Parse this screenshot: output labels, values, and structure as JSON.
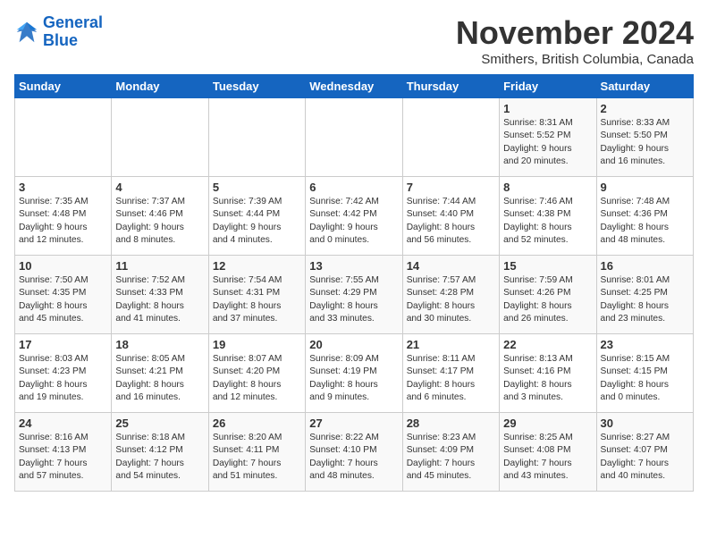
{
  "logo": {
    "line1": "General",
    "line2": "Blue"
  },
  "title": "November 2024",
  "subtitle": "Smithers, British Columbia, Canada",
  "weekdays": [
    "Sunday",
    "Monday",
    "Tuesday",
    "Wednesday",
    "Thursday",
    "Friday",
    "Saturday"
  ],
  "weeks": [
    [
      {
        "day": "",
        "info": ""
      },
      {
        "day": "",
        "info": ""
      },
      {
        "day": "",
        "info": ""
      },
      {
        "day": "",
        "info": ""
      },
      {
        "day": "",
        "info": ""
      },
      {
        "day": "1",
        "info": "Sunrise: 8:31 AM\nSunset: 5:52 PM\nDaylight: 9 hours\nand 20 minutes."
      },
      {
        "day": "2",
        "info": "Sunrise: 8:33 AM\nSunset: 5:50 PM\nDaylight: 9 hours\nand 16 minutes."
      }
    ],
    [
      {
        "day": "3",
        "info": "Sunrise: 7:35 AM\nSunset: 4:48 PM\nDaylight: 9 hours\nand 12 minutes."
      },
      {
        "day": "4",
        "info": "Sunrise: 7:37 AM\nSunset: 4:46 PM\nDaylight: 9 hours\nand 8 minutes."
      },
      {
        "day": "5",
        "info": "Sunrise: 7:39 AM\nSunset: 4:44 PM\nDaylight: 9 hours\nand 4 minutes."
      },
      {
        "day": "6",
        "info": "Sunrise: 7:42 AM\nSunset: 4:42 PM\nDaylight: 9 hours\nand 0 minutes."
      },
      {
        "day": "7",
        "info": "Sunrise: 7:44 AM\nSunset: 4:40 PM\nDaylight: 8 hours\nand 56 minutes."
      },
      {
        "day": "8",
        "info": "Sunrise: 7:46 AM\nSunset: 4:38 PM\nDaylight: 8 hours\nand 52 minutes."
      },
      {
        "day": "9",
        "info": "Sunrise: 7:48 AM\nSunset: 4:36 PM\nDaylight: 8 hours\nand 48 minutes."
      }
    ],
    [
      {
        "day": "10",
        "info": "Sunrise: 7:50 AM\nSunset: 4:35 PM\nDaylight: 8 hours\nand 45 minutes."
      },
      {
        "day": "11",
        "info": "Sunrise: 7:52 AM\nSunset: 4:33 PM\nDaylight: 8 hours\nand 41 minutes."
      },
      {
        "day": "12",
        "info": "Sunrise: 7:54 AM\nSunset: 4:31 PM\nDaylight: 8 hours\nand 37 minutes."
      },
      {
        "day": "13",
        "info": "Sunrise: 7:55 AM\nSunset: 4:29 PM\nDaylight: 8 hours\nand 33 minutes."
      },
      {
        "day": "14",
        "info": "Sunrise: 7:57 AM\nSunset: 4:28 PM\nDaylight: 8 hours\nand 30 minutes."
      },
      {
        "day": "15",
        "info": "Sunrise: 7:59 AM\nSunset: 4:26 PM\nDaylight: 8 hours\nand 26 minutes."
      },
      {
        "day": "16",
        "info": "Sunrise: 8:01 AM\nSunset: 4:25 PM\nDaylight: 8 hours\nand 23 minutes."
      }
    ],
    [
      {
        "day": "17",
        "info": "Sunrise: 8:03 AM\nSunset: 4:23 PM\nDaylight: 8 hours\nand 19 minutes."
      },
      {
        "day": "18",
        "info": "Sunrise: 8:05 AM\nSunset: 4:21 PM\nDaylight: 8 hours\nand 16 minutes."
      },
      {
        "day": "19",
        "info": "Sunrise: 8:07 AM\nSunset: 4:20 PM\nDaylight: 8 hours\nand 12 minutes."
      },
      {
        "day": "20",
        "info": "Sunrise: 8:09 AM\nSunset: 4:19 PM\nDaylight: 8 hours\nand 9 minutes."
      },
      {
        "day": "21",
        "info": "Sunrise: 8:11 AM\nSunset: 4:17 PM\nDaylight: 8 hours\nand 6 minutes."
      },
      {
        "day": "22",
        "info": "Sunrise: 8:13 AM\nSunset: 4:16 PM\nDaylight: 8 hours\nand 3 minutes."
      },
      {
        "day": "23",
        "info": "Sunrise: 8:15 AM\nSunset: 4:15 PM\nDaylight: 8 hours\nand 0 minutes."
      }
    ],
    [
      {
        "day": "24",
        "info": "Sunrise: 8:16 AM\nSunset: 4:13 PM\nDaylight: 7 hours\nand 57 minutes."
      },
      {
        "day": "25",
        "info": "Sunrise: 8:18 AM\nSunset: 4:12 PM\nDaylight: 7 hours\nand 54 minutes."
      },
      {
        "day": "26",
        "info": "Sunrise: 8:20 AM\nSunset: 4:11 PM\nDaylight: 7 hours\nand 51 minutes."
      },
      {
        "day": "27",
        "info": "Sunrise: 8:22 AM\nSunset: 4:10 PM\nDaylight: 7 hours\nand 48 minutes."
      },
      {
        "day": "28",
        "info": "Sunrise: 8:23 AM\nSunset: 4:09 PM\nDaylight: 7 hours\nand 45 minutes."
      },
      {
        "day": "29",
        "info": "Sunrise: 8:25 AM\nSunset: 4:08 PM\nDaylight: 7 hours\nand 43 minutes."
      },
      {
        "day": "30",
        "info": "Sunrise: 8:27 AM\nSunset: 4:07 PM\nDaylight: 7 hours\nand 40 minutes."
      }
    ]
  ]
}
